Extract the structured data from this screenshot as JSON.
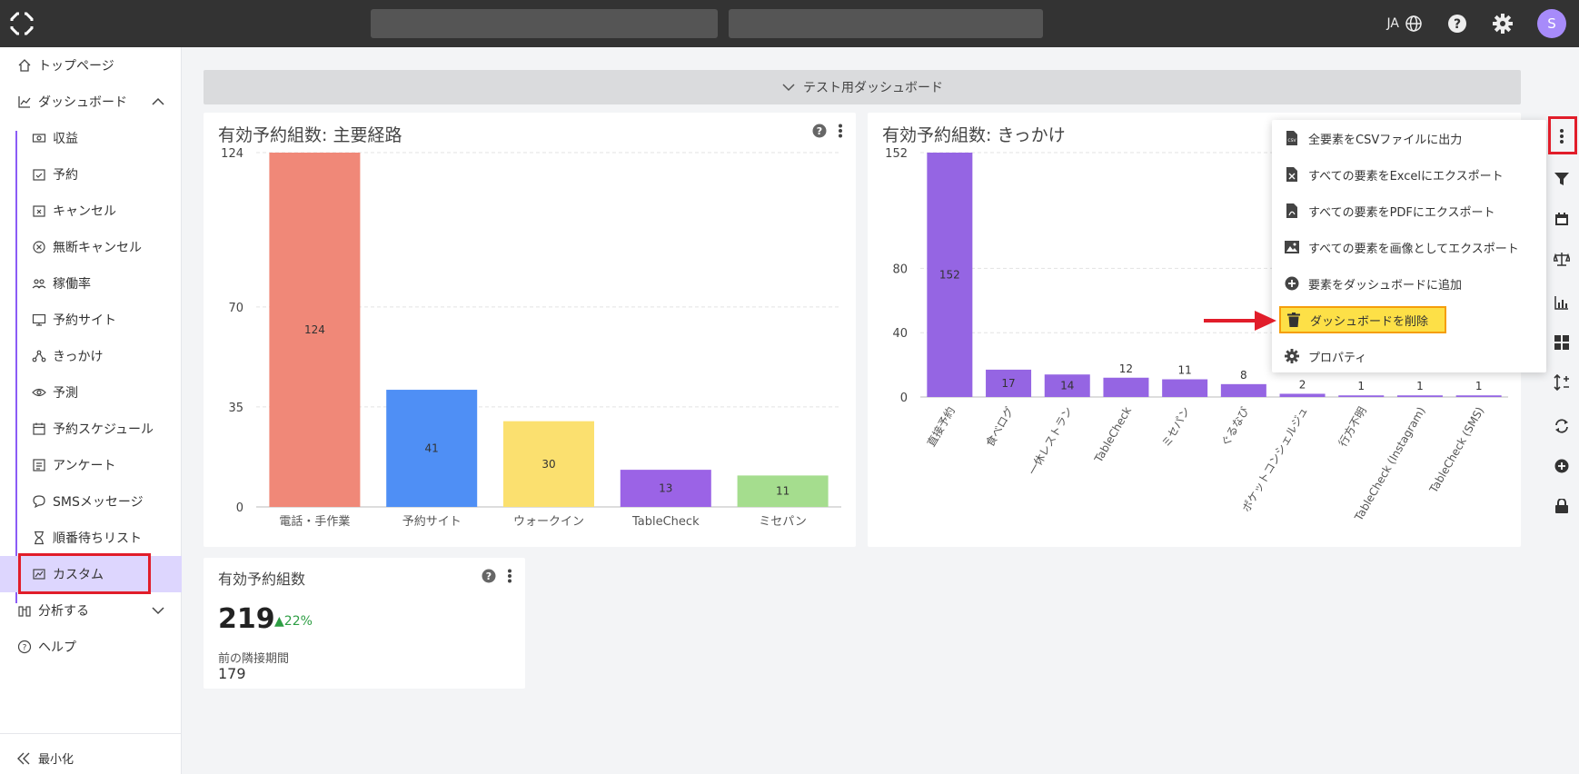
{
  "topbar": {
    "lang": "JA",
    "avatar_initial": "S"
  },
  "sidebar": {
    "home": "トップページ",
    "dashboard": "ダッシュボード",
    "sub_items": [
      "収益",
      "予約",
      "キャンセル",
      "無断キャンセル",
      "稼働率",
      "予約サイト",
      "きっかけ",
      "予測",
      "予約スケジュール",
      "アンケート",
      "SMSメッセージ",
      "順番待ちリスト",
      "カスタム"
    ],
    "analyze": "分析する",
    "help": "ヘルプ",
    "minimize": "最小化"
  },
  "dashboard": {
    "title": "テスト用ダッシュボード"
  },
  "card1": {
    "title": "有効予約組数: 主要経路"
  },
  "card2": {
    "title": "有効予約組数: きっかけ"
  },
  "card3": {
    "title": "有効予約組数",
    "value": "219",
    "change": "22%",
    "prev_label": "前の隣接期間",
    "prev_value": "179"
  },
  "menu": {
    "items": [
      "全要素をCSVファイルに出力",
      "すべての要素をExcelにエクスポート",
      "すべての要素をPDFにエクスポート",
      "すべての要素を画像としてエクスポート",
      "要素をダッシュボードに追加",
      "ダッシュボードを削除",
      "プロパティ"
    ]
  },
  "chart_data": [
    {
      "type": "bar",
      "title": "有効予約組数: 主要経路",
      "categories": [
        "電話・手作業",
        "予約サイト",
        "ウォークイン",
        "TableCheck",
        "ミセパン"
      ],
      "values": [
        124,
        41,
        30,
        13,
        11
      ],
      "colors": [
        "#f08878",
        "#4f8ff5",
        "#fbe06f",
        "#9b63e6",
        "#a5dd8e"
      ],
      "ylim": [
        0,
        124
      ],
      "yticks": [
        0,
        35,
        70,
        124
      ],
      "grid": true
    },
    {
      "type": "bar",
      "title": "有効予約組数: きっかけ",
      "categories": [
        "直接予約",
        "食べログ",
        "一休レストラン",
        "TableCheck",
        "ミセパン",
        "ぐるなび",
        "ポケットコンシェルジュ",
        "行方不明",
        "TableCheck (Instagram)",
        "TableCheck (SMS)"
      ],
      "values": [
        152,
        17,
        14,
        12,
        11,
        8,
        2,
        1,
        1,
        1
      ],
      "color": "#9565e3",
      "ylim": [
        0,
        152
      ],
      "yticks": [
        0,
        40,
        80,
        152
      ],
      "grid": true
    }
  ]
}
